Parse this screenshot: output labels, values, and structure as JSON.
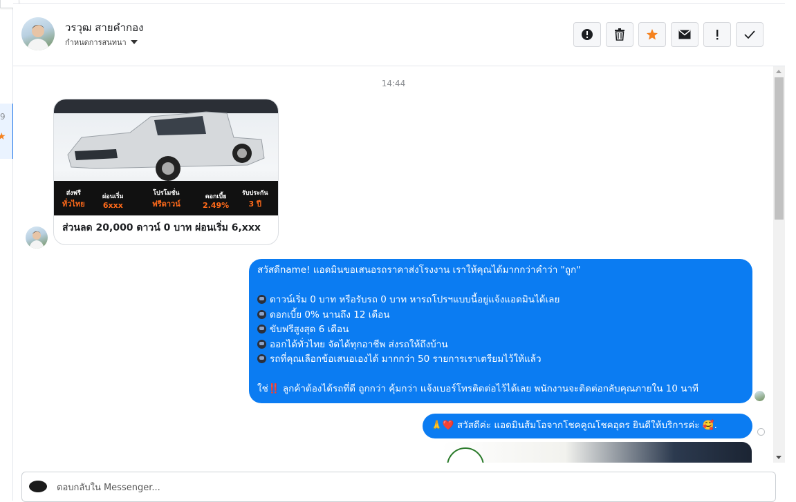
{
  "left_panel": {
    "count": "9"
  },
  "header": {
    "contact_name": "วรวุฒ สายคำกอง",
    "assign_label": "กำหนดการสนทนา",
    "actions": [
      {
        "name": "report-spam-button",
        "icon": "alert-circle-icon"
      },
      {
        "name": "delete-button",
        "icon": "trash-icon"
      },
      {
        "name": "star-button",
        "icon": "star-icon"
      },
      {
        "name": "mark-unread-button",
        "icon": "envelope-icon"
      },
      {
        "name": "important-button",
        "icon": "exclamation-icon"
      },
      {
        "name": "done-button",
        "icon": "check-icon"
      }
    ],
    "star_color": "#f5821f"
  },
  "chat": {
    "timestamp": "14:44",
    "card": {
      "caption": "ส่วนลด 20,000 ดาวน์ 0 บาท ผ่อนเริ่ม 6,xxx",
      "promos": [
        {
          "label": "ส่งฟรี",
          "value": "ทั่วไทย"
        },
        {
          "label": "ผ่อนเริ่ม",
          "value": "6xxx"
        },
        {
          "label": "โปรโมชั่น",
          "value": "ฟรีดาวน์"
        },
        {
          "label": "ดอกเบี้ย",
          "value": "2.49%"
        },
        {
          "label": "รับประกัน",
          "value": "3 ปี"
        }
      ]
    },
    "message1": {
      "intro": "สวัสดีname! แอดมินขอเสนอรถราคาส่งโรงงาน เราให้คุณได้มากกว่าคำว่า \"ถูก\"",
      "items": [
        "ดาวน์เริ่ม 0 บาท หรือรับรถ 0 บาท หารถโปรฯแบบนี้อยู่แจ้งแอดมินได้เลย",
        "ดอกเบี้ย 0% นานถึง 12 เดือน",
        "ขับฟรีสูงสุด 6 เดือน",
        "ออกได้ทั่วไทย จัดได้ทุกอาชีพ ส่งรถให้ถึงบ้าน",
        "รถที่คุณเลือกข้อเสนอเองได้ มากกว่า 50 รายการเราเตรียมไว้ให้แล้ว"
      ],
      "closing_prefix": "ใช่",
      "closing_emoji": "‼️",
      "closing": "ลูกค้าต้องได้รถที่ดี ถูกกว่า คุ้มกว่า แจ้งเบอร์โทรติดต่อไว้ได้เลย พนักงานจะติดต่อกลับคุณภายใน 10 นาที"
    },
    "message2": {
      "emoji_start": "🙏❤️",
      "text": "สวัสดีค่ะ แอดมินส้มโอจากโชคคูณโชคอุดร ยินดีให้บริการค่ะ",
      "emoji_end": "🥰."
    },
    "bubble_color": "#0b7cf2"
  },
  "reply": {
    "placeholder": "ตอบกลับใน Messenger..."
  }
}
